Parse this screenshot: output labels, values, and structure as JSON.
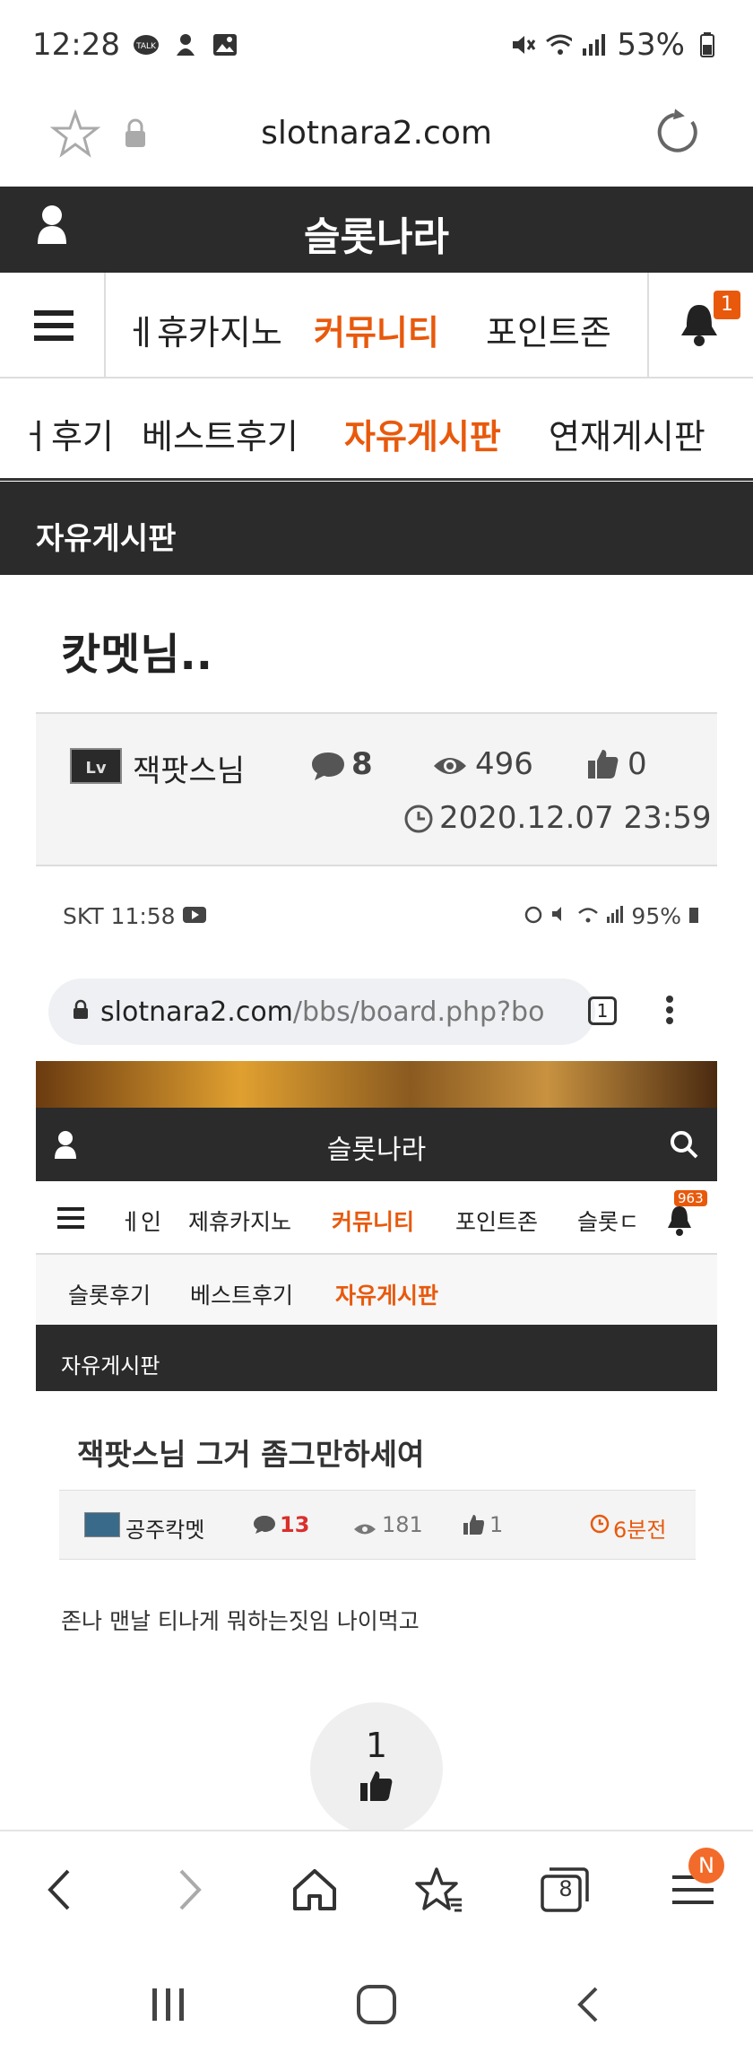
{
  "status_bar": {
    "time": "12:28",
    "battery": "53%"
  },
  "browser": {
    "url": "slotnara2.com"
  },
  "site": {
    "title": "슬롯나라"
  },
  "nav_main": {
    "items": [
      "ㅔ휴카지노",
      "커뮤니티",
      "포인트존"
    ],
    "active": "커뮤니티",
    "notification_count": "1"
  },
  "nav_sub": {
    "items": [
      "ㅓ후기",
      "베스트후기",
      "자유게시판",
      "연재게시판"
    ],
    "active": "자유게시판"
  },
  "board_title": "자유게시판",
  "post": {
    "title": "캇멧님..",
    "author": "잭팟스님",
    "comments": "8",
    "views": "496",
    "likes": "0",
    "date": "2020.12.07 23:59"
  },
  "embedded_screenshot": {
    "status_left": "SKT 11:58",
    "status_right": "95%",
    "url_host": "slotnara2.com",
    "url_path": "/bbs/board.php?bo",
    "tab_count": "1",
    "site_title": "슬롯나라",
    "nav_items": [
      "ㅔ인",
      "제휴카지노",
      "커뮤니티",
      "포인트존",
      "슬롯ㄷ"
    ],
    "nav_active": "커뮤니티",
    "notification_count": "963",
    "sub_items": [
      "슬롯후기",
      "베스트후기",
      "자유게시판"
    ],
    "sub_active": "자유게시판",
    "board_title": "자유게시판",
    "post_title": "잭팟스님 그거 좀그만하세여",
    "author": "공주칵멧",
    "comments": "13",
    "views": "181",
    "likes": "1",
    "time_ago": "6분전",
    "body": "존나 맨날 티나게 뭐하는짓임 나이먹고"
  },
  "like_count": "1",
  "toolbar": {
    "tabs_count": "8",
    "menu_badge": "N"
  },
  "colors": {
    "accent": "#e8590c",
    "dark": "#2b2b2b",
    "comment_red": "#d9302c"
  }
}
